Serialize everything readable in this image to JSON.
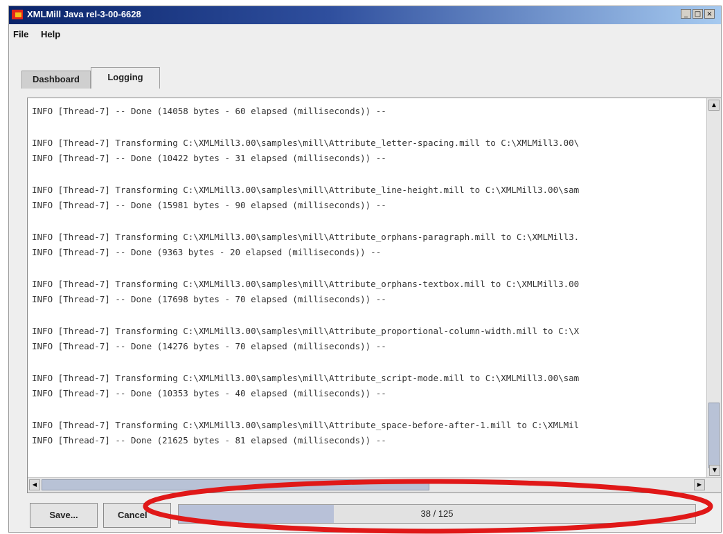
{
  "window": {
    "title": "XMLMill Java rel-3-00-6628",
    "controls": {
      "minimize": "_",
      "maximize": "□",
      "close": "×"
    }
  },
  "menu": {
    "file": "File",
    "help": "Help"
  },
  "tabs": {
    "dashboard": "Dashboard",
    "logging": "Logging",
    "active": "logging"
  },
  "log": {
    "lines": [
      "INFO [Thread-7] -- Done (14058 bytes - 60 elapsed (milliseconds)) --",
      "INFO [Thread-7] Transforming C:\\XMLMill3.00\\samples\\mill\\Attribute_letter-spacing.mill to C:\\XMLMill3.00\\",
      "INFO [Thread-7] -- Done (10422 bytes - 31 elapsed (milliseconds)) --",
      "INFO [Thread-7] Transforming C:\\XMLMill3.00\\samples\\mill\\Attribute_line-height.mill to C:\\XMLMill3.00\\sam",
      "INFO [Thread-7] -- Done (15981 bytes - 90 elapsed (milliseconds)) --",
      "INFO [Thread-7] Transforming C:\\XMLMill3.00\\samples\\mill\\Attribute_orphans-paragraph.mill to C:\\XMLMill3.",
      "INFO [Thread-7] -- Done (9363 bytes - 20 elapsed (milliseconds)) --",
      "INFO [Thread-7] Transforming C:\\XMLMill3.00\\samples\\mill\\Attribute_orphans-textbox.mill to C:\\XMLMill3.00",
      "INFO [Thread-7] -- Done (17698 bytes - 70 elapsed (milliseconds)) --",
      "INFO [Thread-7] Transforming C:\\XMLMill3.00\\samples\\mill\\Attribute_proportional-column-width.mill to C:\\X",
      "INFO [Thread-7] -- Done (14276 bytes - 70 elapsed (milliseconds)) --",
      "INFO [Thread-7] Transforming C:\\XMLMill3.00\\samples\\mill\\Attribute_script-mode.mill to C:\\XMLMill3.00\\sam",
      "INFO [Thread-7] -- Done (10353 bytes - 40 elapsed (milliseconds)) --",
      "INFO [Thread-7] Transforming C:\\XMLMill3.00\\samples\\mill\\Attribute_space-before-after-1.mill to C:\\XMLMil",
      "INFO [Thread-7] -- Done (21625 bytes - 81 elapsed (milliseconds)) --"
    ]
  },
  "buttons": {
    "save": "Save...",
    "cancel": "Cancel"
  },
  "progress": {
    "text": "38 / 125",
    "fraction": 0.3
  },
  "colors": {
    "annotation": "#e01818",
    "titlebar_start": "#0a246a",
    "titlebar_end": "#a6caf0"
  },
  "icons": {
    "app": "xmlmill-app-icon",
    "scroll_up": "arrow-up-icon",
    "scroll_down": "arrow-down-icon",
    "scroll_left": "arrow-left-icon",
    "scroll_right": "arrow-right-icon"
  }
}
